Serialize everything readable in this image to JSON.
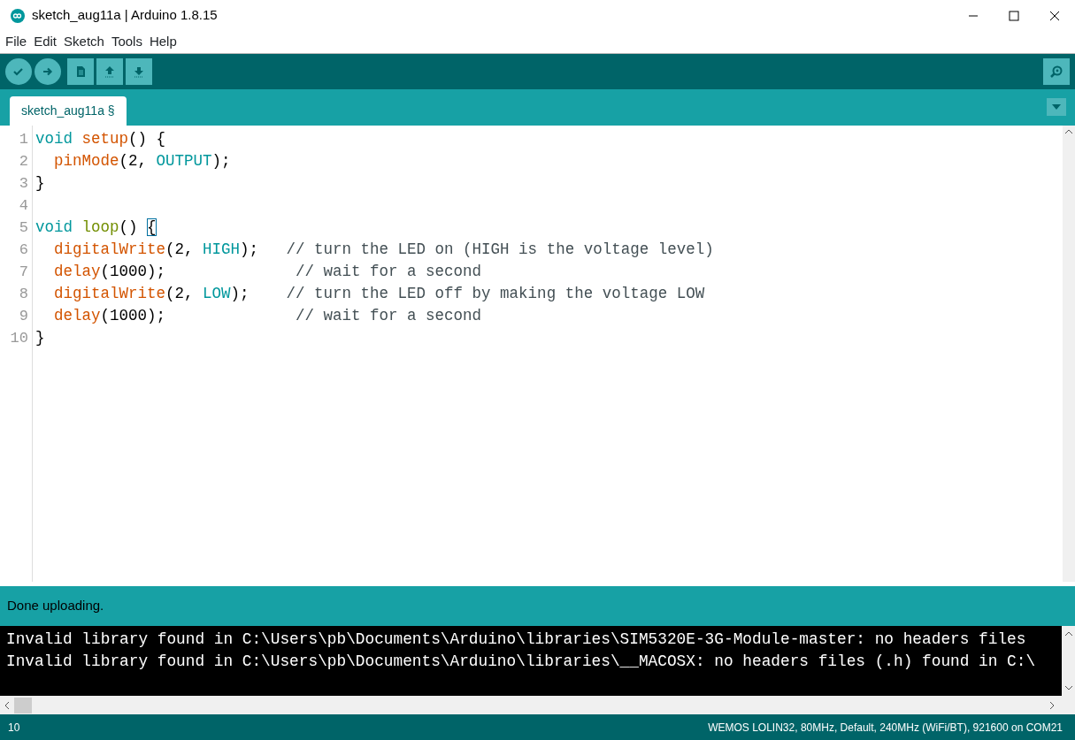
{
  "window": {
    "title": "sketch_aug11a | Arduino 1.8.15"
  },
  "menu": [
    "File",
    "Edit",
    "Sketch",
    "Tools",
    "Help"
  ],
  "tabs": [
    {
      "label": "sketch_aug11a §",
      "selected": true
    }
  ],
  "editor": {
    "lines": [
      {
        "number": "1",
        "tokens": [
          {
            "kind": "keyword",
            "text": "void "
          },
          {
            "kind": "function",
            "text": "setup"
          },
          {
            "kind": "plain",
            "text": "() {"
          }
        ]
      },
      {
        "number": "2",
        "tokens": [
          {
            "kind": "function",
            "text": "  pinMode"
          },
          {
            "kind": "plain",
            "text": "(2, "
          },
          {
            "kind": "constant",
            "text": "OUTPUT"
          },
          {
            "kind": "plain",
            "text": ");"
          }
        ]
      },
      {
        "number": "3",
        "tokens": [
          {
            "kind": "plain",
            "text": "}"
          }
        ]
      },
      {
        "number": "4"
      },
      {
        "number": "5",
        "tokens": [
          {
            "kind": "keyword",
            "text": "void "
          },
          {
            "kind": "loop",
            "text": "loop"
          },
          {
            "kind": "plain",
            "text": "() "
          },
          {
            "kind": "matched-brace",
            "text": "{"
          }
        ]
      },
      {
        "number": "6",
        "tokens": [
          {
            "kind": "function",
            "text": "  digitalWrite"
          },
          {
            "kind": "plain",
            "text": "(2, "
          },
          {
            "kind": "constant",
            "text": "HIGH"
          },
          {
            "kind": "plain",
            "text": ");   "
          },
          {
            "kind": "comment",
            "text": "// turn the LED on (HIGH is the voltage level)"
          }
        ]
      },
      {
        "number": "7",
        "tokens": [
          {
            "kind": "function",
            "text": "  delay"
          },
          {
            "kind": "plain",
            "text": "(1000);              "
          },
          {
            "kind": "comment",
            "text": "// wait for a second"
          }
        ]
      },
      {
        "number": "8",
        "tokens": [
          {
            "kind": "function",
            "text": "  digitalWrite"
          },
          {
            "kind": "plain",
            "text": "(2, "
          },
          {
            "kind": "constant",
            "text": "LOW"
          },
          {
            "kind": "plain",
            "text": ");    "
          },
          {
            "kind": "comment",
            "text": "// turn the LED off by making the voltage LOW"
          }
        ]
      },
      {
        "number": "9",
        "tokens": [
          {
            "kind": "function",
            "text": "  delay"
          },
          {
            "kind": "plain",
            "text": "(1000);              "
          },
          {
            "kind": "comment",
            "text": "// wait for a second"
          }
        ]
      },
      {
        "number": "10",
        "tokens": [
          {
            "kind": "plain",
            "text": "}"
          }
        ]
      }
    ]
  },
  "status": {
    "message": "Done uploading."
  },
  "console": {
    "lines": [
      "Invalid library found in C:\\Users\\pb\\Documents\\Arduino\\libraries\\SIM5320E-3G-Module-master: no headers files",
      "Invalid library found in C:\\Users\\pb\\Documents\\Arduino\\libraries\\__MACOSX: no headers files (.h) found in C:\\"
    ]
  },
  "status_bar": {
    "line": "10",
    "board": "WEMOS LOLIN32, 80MHz, Default, 240MHz (WiFi/BT), 921600 on COM21"
  }
}
